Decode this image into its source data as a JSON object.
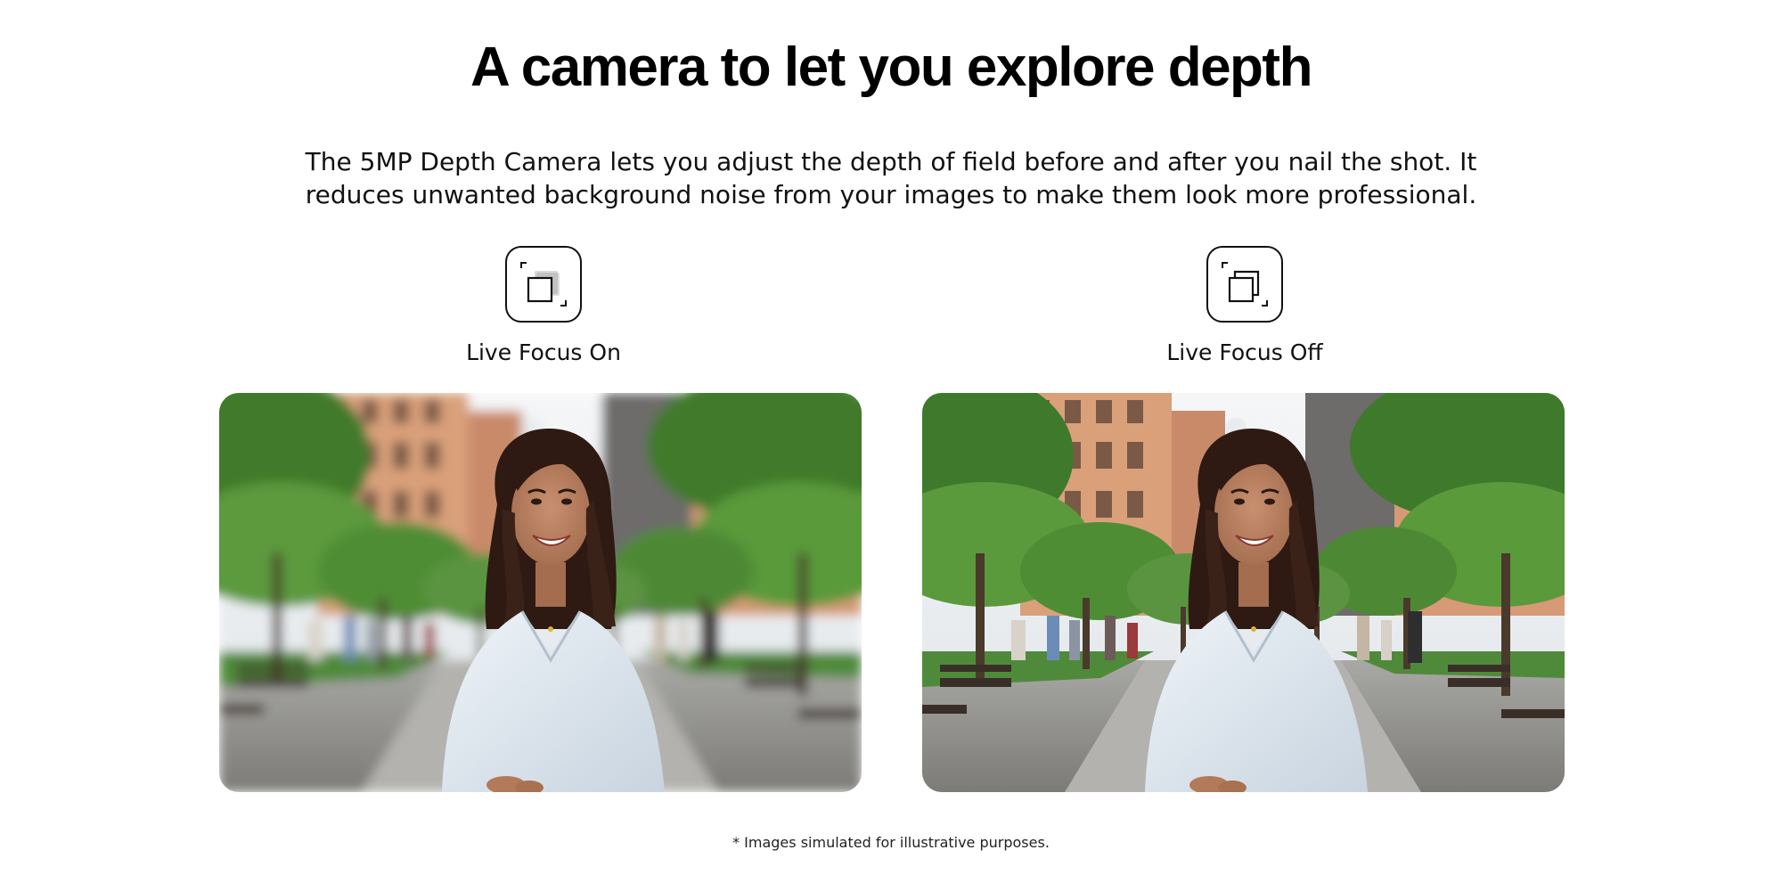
{
  "page": {
    "headline": "A camera to let you explore depth",
    "description": "The 5MP Depth Camera lets you adjust the depth of field before and after you nail the shot. It reduces unwanted background noise from your images to make them look more professional.",
    "disclaimer": "* Images simulated for illustrative purposes."
  },
  "modes": [
    {
      "label": "Live Focus On",
      "icon": "live-focus-on-icon"
    },
    {
      "label": "Live Focus Off",
      "icon": "live-focus-off-icon"
    }
  ],
  "colors": {
    "text": "#111111",
    "background": "#ffffff",
    "building": "#d9a07a",
    "foliage": "#4e8a36",
    "pavement": "#9a9a98",
    "sky": "#eef1f4",
    "shirt": "#dfe8f0",
    "hair": "#2e1a12",
    "skin": "#b98060"
  }
}
